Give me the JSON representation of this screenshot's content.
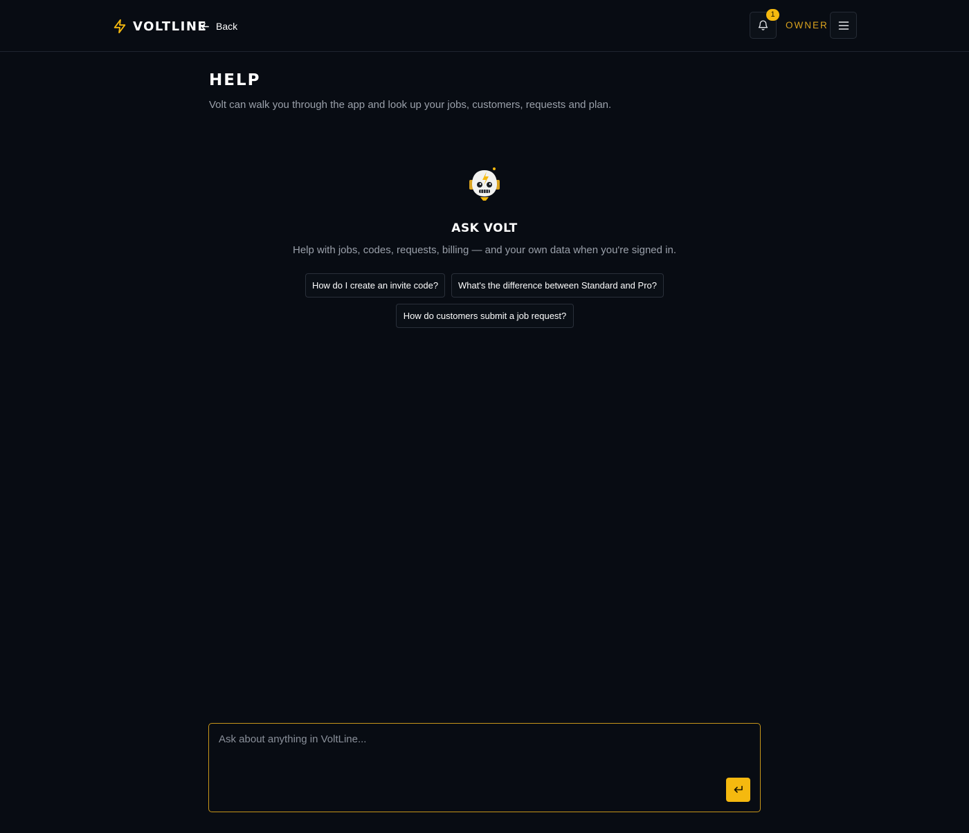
{
  "header": {
    "brand_name": "VOLTLINE",
    "back_label": "Back",
    "notification_count": "1",
    "role_label": "OWNER"
  },
  "page": {
    "title": "HELP",
    "subtitle": "Volt can walk you through the app and look up your jobs, customers, requests and plan."
  },
  "assistant": {
    "title": "ASK VOLT",
    "subtitle": "Help with jobs, codes, requests, billing — and your own data when you're signed in.",
    "suggestions": [
      "How do I create an invite code?",
      "What's the difference between Standard and Pro?",
      "How do customers submit a job request?"
    ]
  },
  "composer": {
    "placeholder": "Ask about anything in VoltLine...",
    "value": ""
  },
  "colors": {
    "background": "#080c13",
    "accent": "#f5b90f",
    "role_text": "#d9a21e",
    "muted_text": "#9aa0aa",
    "border": "#262c36"
  },
  "icons": {
    "brand": "lightning-bolt-icon",
    "back": "arrow-left-icon",
    "notifications": "bell-icon",
    "menu": "hamburger-menu-icon",
    "mascot": "robot-mascot-icon",
    "send": "enter-return-icon"
  }
}
